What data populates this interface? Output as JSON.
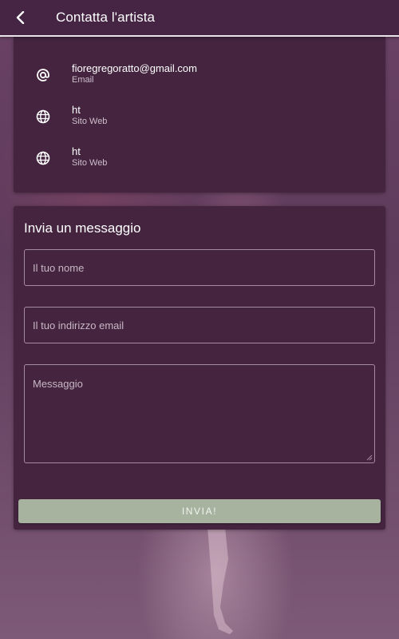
{
  "header": {
    "title": "Contatta l'artista",
    "back_icon": "chevron-left-icon"
  },
  "contacts": [
    {
      "icon": "at-sign-icon",
      "value": "fioregregoratto@gmail.com",
      "label": "Email"
    },
    {
      "icon": "globe-icon",
      "value": "ht",
      "label": "Sito Web"
    },
    {
      "icon": "globe-icon",
      "value": "ht",
      "label": "Sito Web"
    }
  ],
  "form": {
    "title": "Invia un messaggio",
    "name_placeholder": "Il tuo nome",
    "email_placeholder": "Il tuo indirizzo email",
    "message_placeholder": "Messaggio",
    "send_label": "INVIA!"
  },
  "colors": {
    "header_bg": "#452444",
    "card_bg": "#44243f",
    "button_bg": "#a7b29f",
    "page_bg": "#5f3a57"
  }
}
